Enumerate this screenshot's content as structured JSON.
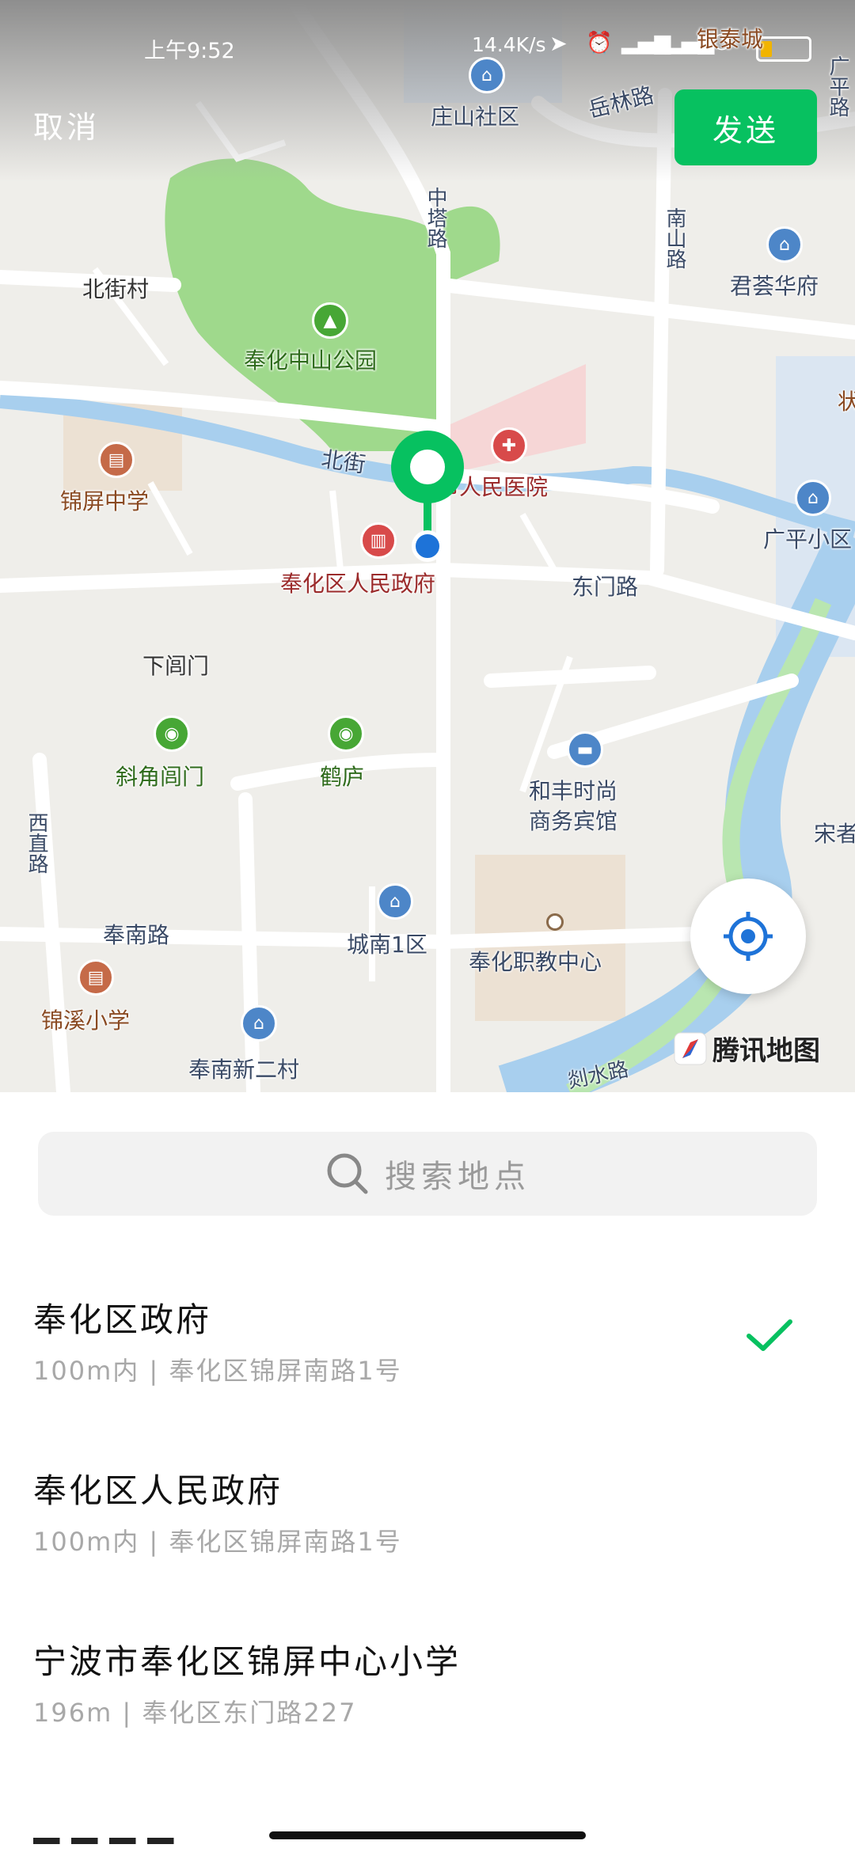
{
  "status_bar": {
    "time": "上午9:52",
    "network_speed": "14.4K/s",
    "icons": [
      "location-arrow-icon",
      "alarm-icon",
      "signal-hd-icon",
      "signal-hd-icon",
      "wifi-icon",
      "battery-icon"
    ]
  },
  "header": {
    "cancel_label": "取消",
    "send_label": "发送"
  },
  "map": {
    "labels": {
      "zhuangshan": "庄山社区",
      "yuelin": "岳林路",
      "guangping_road": "广平路",
      "zhongta": "中塔路",
      "nanshan": "南山路",
      "junhui": "君荟华府",
      "beijie_village": "北街村",
      "zhongshan_park": "奉化中山公园",
      "jinping_middle": "锦屏中学",
      "beijie": "北街",
      "hospital": "市人民医院",
      "gov": "奉化区人民政府",
      "dongmen": "东门路",
      "guangping_xiao": "广平小区",
      "xiachuangmen": "下闾门",
      "xiejiao": "斜角闾门",
      "helu": "鹤庐",
      "hefeng_1": "和丰时尚",
      "hefeng_2": "商务宾馆",
      "xizhi": "西直路",
      "songjia": "宋者",
      "fengnan_road": "奉南路",
      "chengnan": "城南1区",
      "vocational": "奉化职教中心",
      "jinxi": "锦溪小学",
      "fengnan_village": "奉南新二村",
      "shui_road": "剡水路",
      "yinta_city": "银泰城",
      "edge_shui": "状"
    },
    "brand_label": "腾讯地图",
    "marker_color": "#07c160",
    "user_dot_color": "#1e73d8"
  },
  "search": {
    "placeholder": "搜索地点"
  },
  "places": [
    {
      "name": "奉化区政府",
      "address": "100m内 | 奉化区锦屏南路1号",
      "selected": true
    },
    {
      "name": "奉化区人民政府",
      "address": "100m内 | 奉化区锦屏南路1号",
      "selected": false
    },
    {
      "name": "宁波市奉化区锦屏中心小学",
      "address": "196m | 奉化区东门路227",
      "selected": false
    }
  ],
  "colors": {
    "accent": "#07c160",
    "water": "#a8cfee",
    "park": "#9fd98c"
  }
}
